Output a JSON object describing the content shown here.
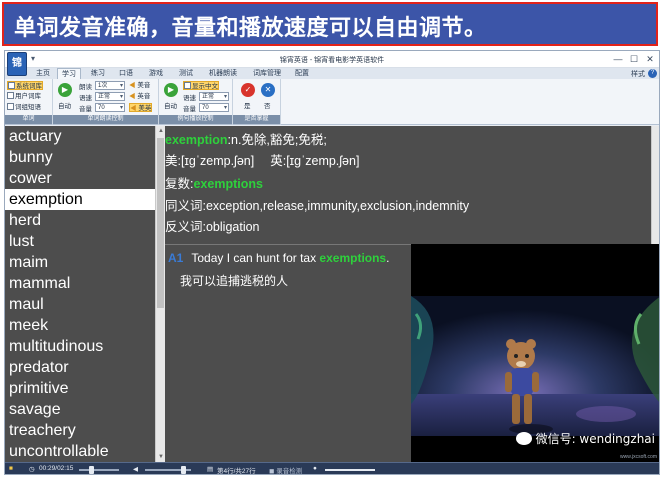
{
  "banner": {
    "text": "单词发音准确，音量和播放速度可以自由调节。"
  },
  "window": {
    "title": "锦宵英语 - 锦宵看电影学英语软件",
    "logo_text": "锦"
  },
  "menu_tabs": [
    "主页",
    "学习",
    "练习",
    "口语",
    "游戏",
    "测试",
    "机器朗读",
    "词库管理",
    "配置"
  ],
  "active_tab": "学习",
  "style_label": "样式",
  "ribbon": {
    "group1": {
      "label": "单词",
      "items": [
        "系统词库",
        "用户词库",
        "词组短语"
      ],
      "selected": "系统词库"
    },
    "group2": {
      "label": "单词朗读控制",
      "auto": "自动",
      "rows": [
        {
          "label": "朗读",
          "value": "1次"
        },
        {
          "label": "语速",
          "value": "正常"
        },
        {
          "label": "音量",
          "value": "70"
        }
      ],
      "accents": [
        "美音",
        "英音",
        "美英"
      ],
      "selected_accent": "美英"
    },
    "group3": {
      "label": "例句播放控制",
      "auto": "自动",
      "show_chinese": "显示中文",
      "rows": [
        {
          "label": "语速",
          "value": "正常"
        },
        {
          "label": "音量",
          "value": "70"
        }
      ]
    },
    "group4": {
      "label": "是否掌握",
      "yes": "是",
      "no": "否"
    }
  },
  "words": [
    "actuary",
    "bunny",
    "cower",
    "exemption",
    "herd",
    "lust",
    "maim",
    "mammal",
    "maul",
    "meek",
    "multitudinous",
    "predator",
    "primitive",
    "savage",
    "treachery",
    "uncontrollable"
  ],
  "selected_word": "exemption",
  "definition": {
    "word": "exemption",
    "meaning": ":n.免除,豁免;免税;",
    "us_label": "美:",
    "us_ipa": "[ɪɡˈzemp.ʃən]",
    "uk_label": "英:",
    "uk_ipa": "[ɪɡˈzemp.ʃən]",
    "plural_label": "复数:",
    "plural": "exemptions",
    "synonyms_label": "同义词:",
    "synonyms": "exception,release,immunity,exclusion,indemnity",
    "antonyms_label": "反义词:",
    "antonyms": "obligation"
  },
  "example": {
    "num": "A1",
    "text_before": "Today I can hunt for tax ",
    "highlight": "exemptions",
    "text_after": ".",
    "translation": "我可以追捕逃税的人"
  },
  "watermark": {
    "text": "微信号: wendingzhai",
    "url": "www.jxcsoft.com"
  },
  "status": {
    "time": "00:29/02:15",
    "row_info": "第4行/共27行",
    "recording": "录音检测"
  },
  "colors": {
    "banner_bg": "#3c55a8",
    "banner_border": "#e2231a",
    "highlight": "#2ed13c",
    "panel_bg": "#4d4d4d"
  }
}
